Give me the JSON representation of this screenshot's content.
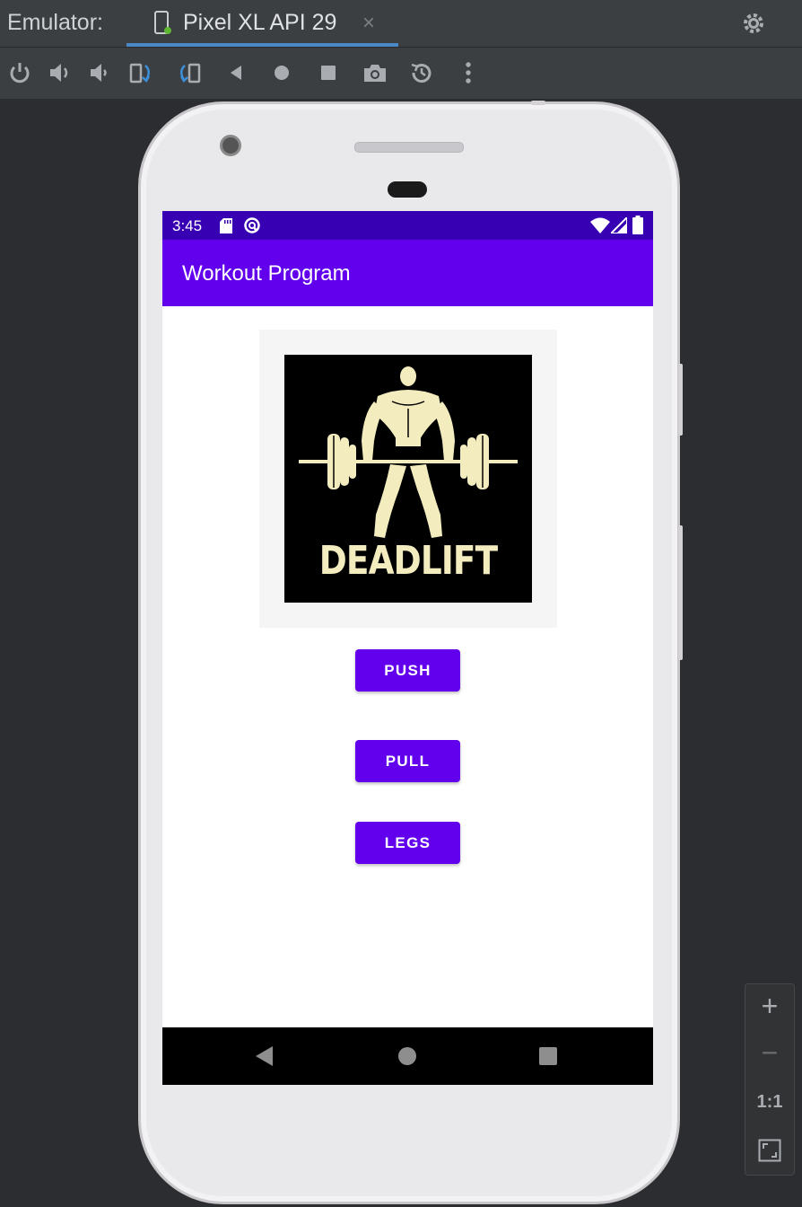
{
  "emulator": {
    "title": "Emulator:",
    "tab_label": "Pixel XL API 29",
    "tab_close": "×"
  },
  "toolbar": {
    "icons": [
      "power-icon",
      "volume-up-icon",
      "volume-down-icon",
      "rotate-left-icon",
      "rotate-right-icon",
      "back-icon",
      "home-icon",
      "overview-icon",
      "screenshot-icon",
      "snapshot-icon",
      "more-icon"
    ]
  },
  "device": {
    "status_bar": {
      "time": "3:45"
    },
    "app_bar": {
      "title": "Workout Program"
    },
    "poster": {
      "caption": "DEADLIFT"
    },
    "buttons": {
      "push": "PUSH",
      "pull": "PULL",
      "legs": "LEGS"
    }
  },
  "zoom": {
    "zoom_in": "+",
    "zoom_out": "−",
    "actual_size": "1:1"
  },
  "colors": {
    "status_bar": "#3700b3",
    "app_bar": "#6200ee",
    "button": "#6200ee",
    "ide_background": "#2b2d30",
    "tab_accent": "#4a88c7"
  }
}
